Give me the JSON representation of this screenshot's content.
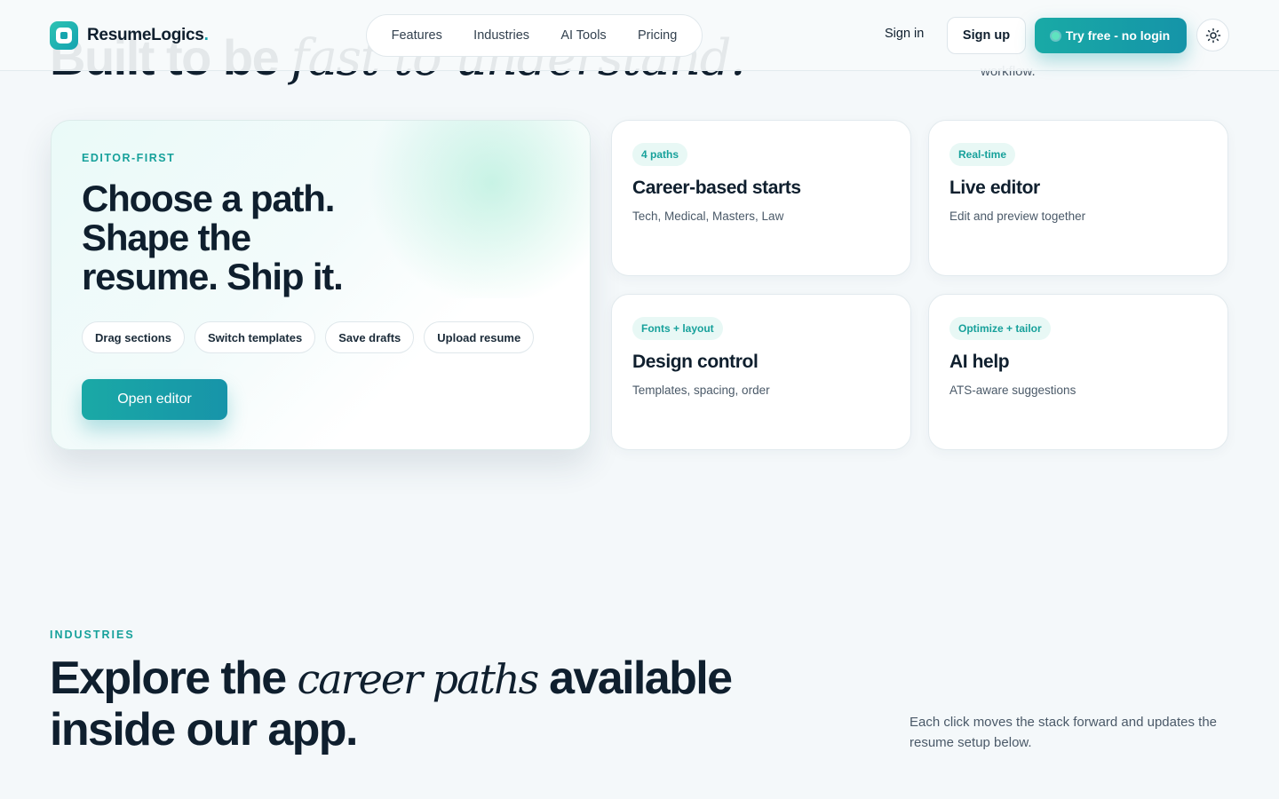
{
  "header": {
    "logo_text": "ResumeLogics",
    "logo_dot": ".",
    "nav": [
      "Features",
      "Industries",
      "AI Tools",
      "Pricing"
    ],
    "sign_in": "Sign in",
    "sign_up": "Sign up",
    "try_free": "Try free - no login",
    "theme_icon": "sun-icon"
  },
  "peek": {
    "heading_plain": "Built to be",
    "heading_serif": "fast to understand.",
    "side_text": "workflow."
  },
  "hero": {
    "eyebrow": "EDITOR-FIRST",
    "title_lines": [
      "Choose a path.",
      "Shape the",
      "resume. Ship it."
    ],
    "chips": [
      "Drag sections",
      "Switch templates",
      "Save drafts",
      "Upload resume"
    ],
    "cta": "Open editor"
  },
  "features": [
    {
      "tag": "4 paths",
      "title": "Career-based starts",
      "desc": "Tech, Medical, Masters, Law"
    },
    {
      "tag": "Real-time",
      "title": "Live editor",
      "desc": "Edit and preview together"
    },
    {
      "tag": "Fonts + layout",
      "title": "Design control",
      "desc": "Templates, spacing, order"
    },
    {
      "tag": "Optimize + tailor",
      "title": "AI help",
      "desc": "ATS-aware suggestions"
    }
  ],
  "industries": {
    "eyebrow": "INDUSTRIES",
    "title_before": "Explore the ",
    "title_serif": "career paths",
    "title_after": " available inside our app.",
    "desc": "Each click moves the stack forward and updates the resume setup below."
  },
  "colors": {
    "accent": "#17a19b",
    "background": "#f4f8fa",
    "text": "#0f1f2e"
  }
}
